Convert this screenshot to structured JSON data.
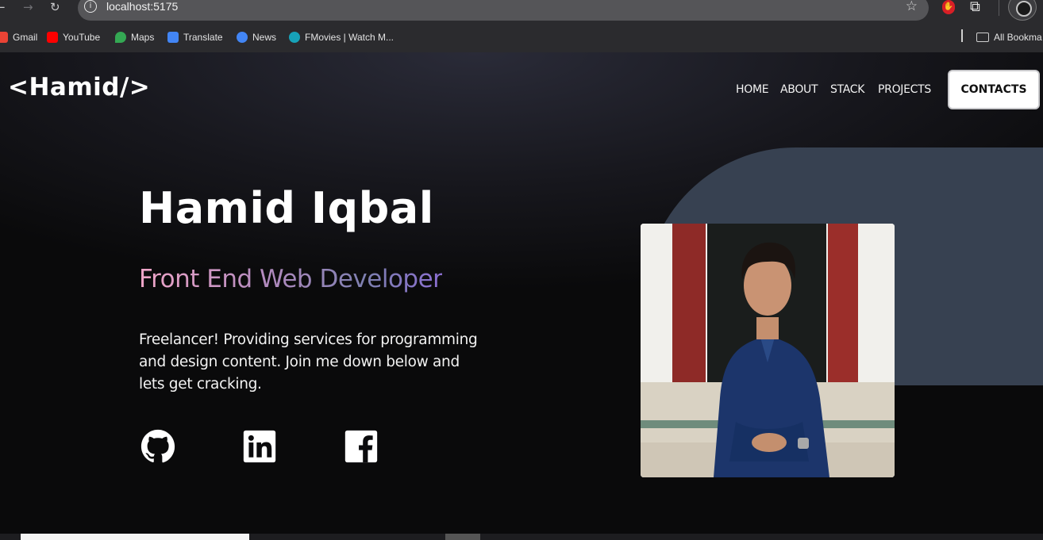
{
  "browser": {
    "url": "localhost:5175",
    "bookmarks": [
      {
        "label": "Gmail",
        "color": "#ea4335"
      },
      {
        "label": "YouTube",
        "color": "#ff0000"
      },
      {
        "label": "Maps",
        "color": "#34a853"
      },
      {
        "label": "Translate",
        "color": "#4285f4"
      },
      {
        "label": "News",
        "color": "#4285f4"
      },
      {
        "label": "FMovies | Watch M...",
        "color": "#17a2b8"
      }
    ],
    "all_bookmarks_label": "All Bookma"
  },
  "site": {
    "logo": "<Hamid/>",
    "nav": [
      {
        "label": "HOME"
      },
      {
        "label": "ABOUT"
      },
      {
        "label": "STACK"
      },
      {
        "label": "PROJECTS"
      }
    ],
    "contact_label": "CONTACTS"
  },
  "hero": {
    "name": "Hamid Iqbal",
    "role": "Front End Web Developer",
    "description": "Freelancer! Providing services for programming and design content. Join me down below and lets get cracking.",
    "socials": [
      {
        "icon": "github-icon"
      },
      {
        "icon": "linkedin-icon"
      },
      {
        "icon": "facebook-icon"
      }
    ]
  },
  "colors": {
    "accent_blob": "#374151",
    "role_gradient": [
      "#f0a6c8",
      "#8b6fd1"
    ]
  }
}
